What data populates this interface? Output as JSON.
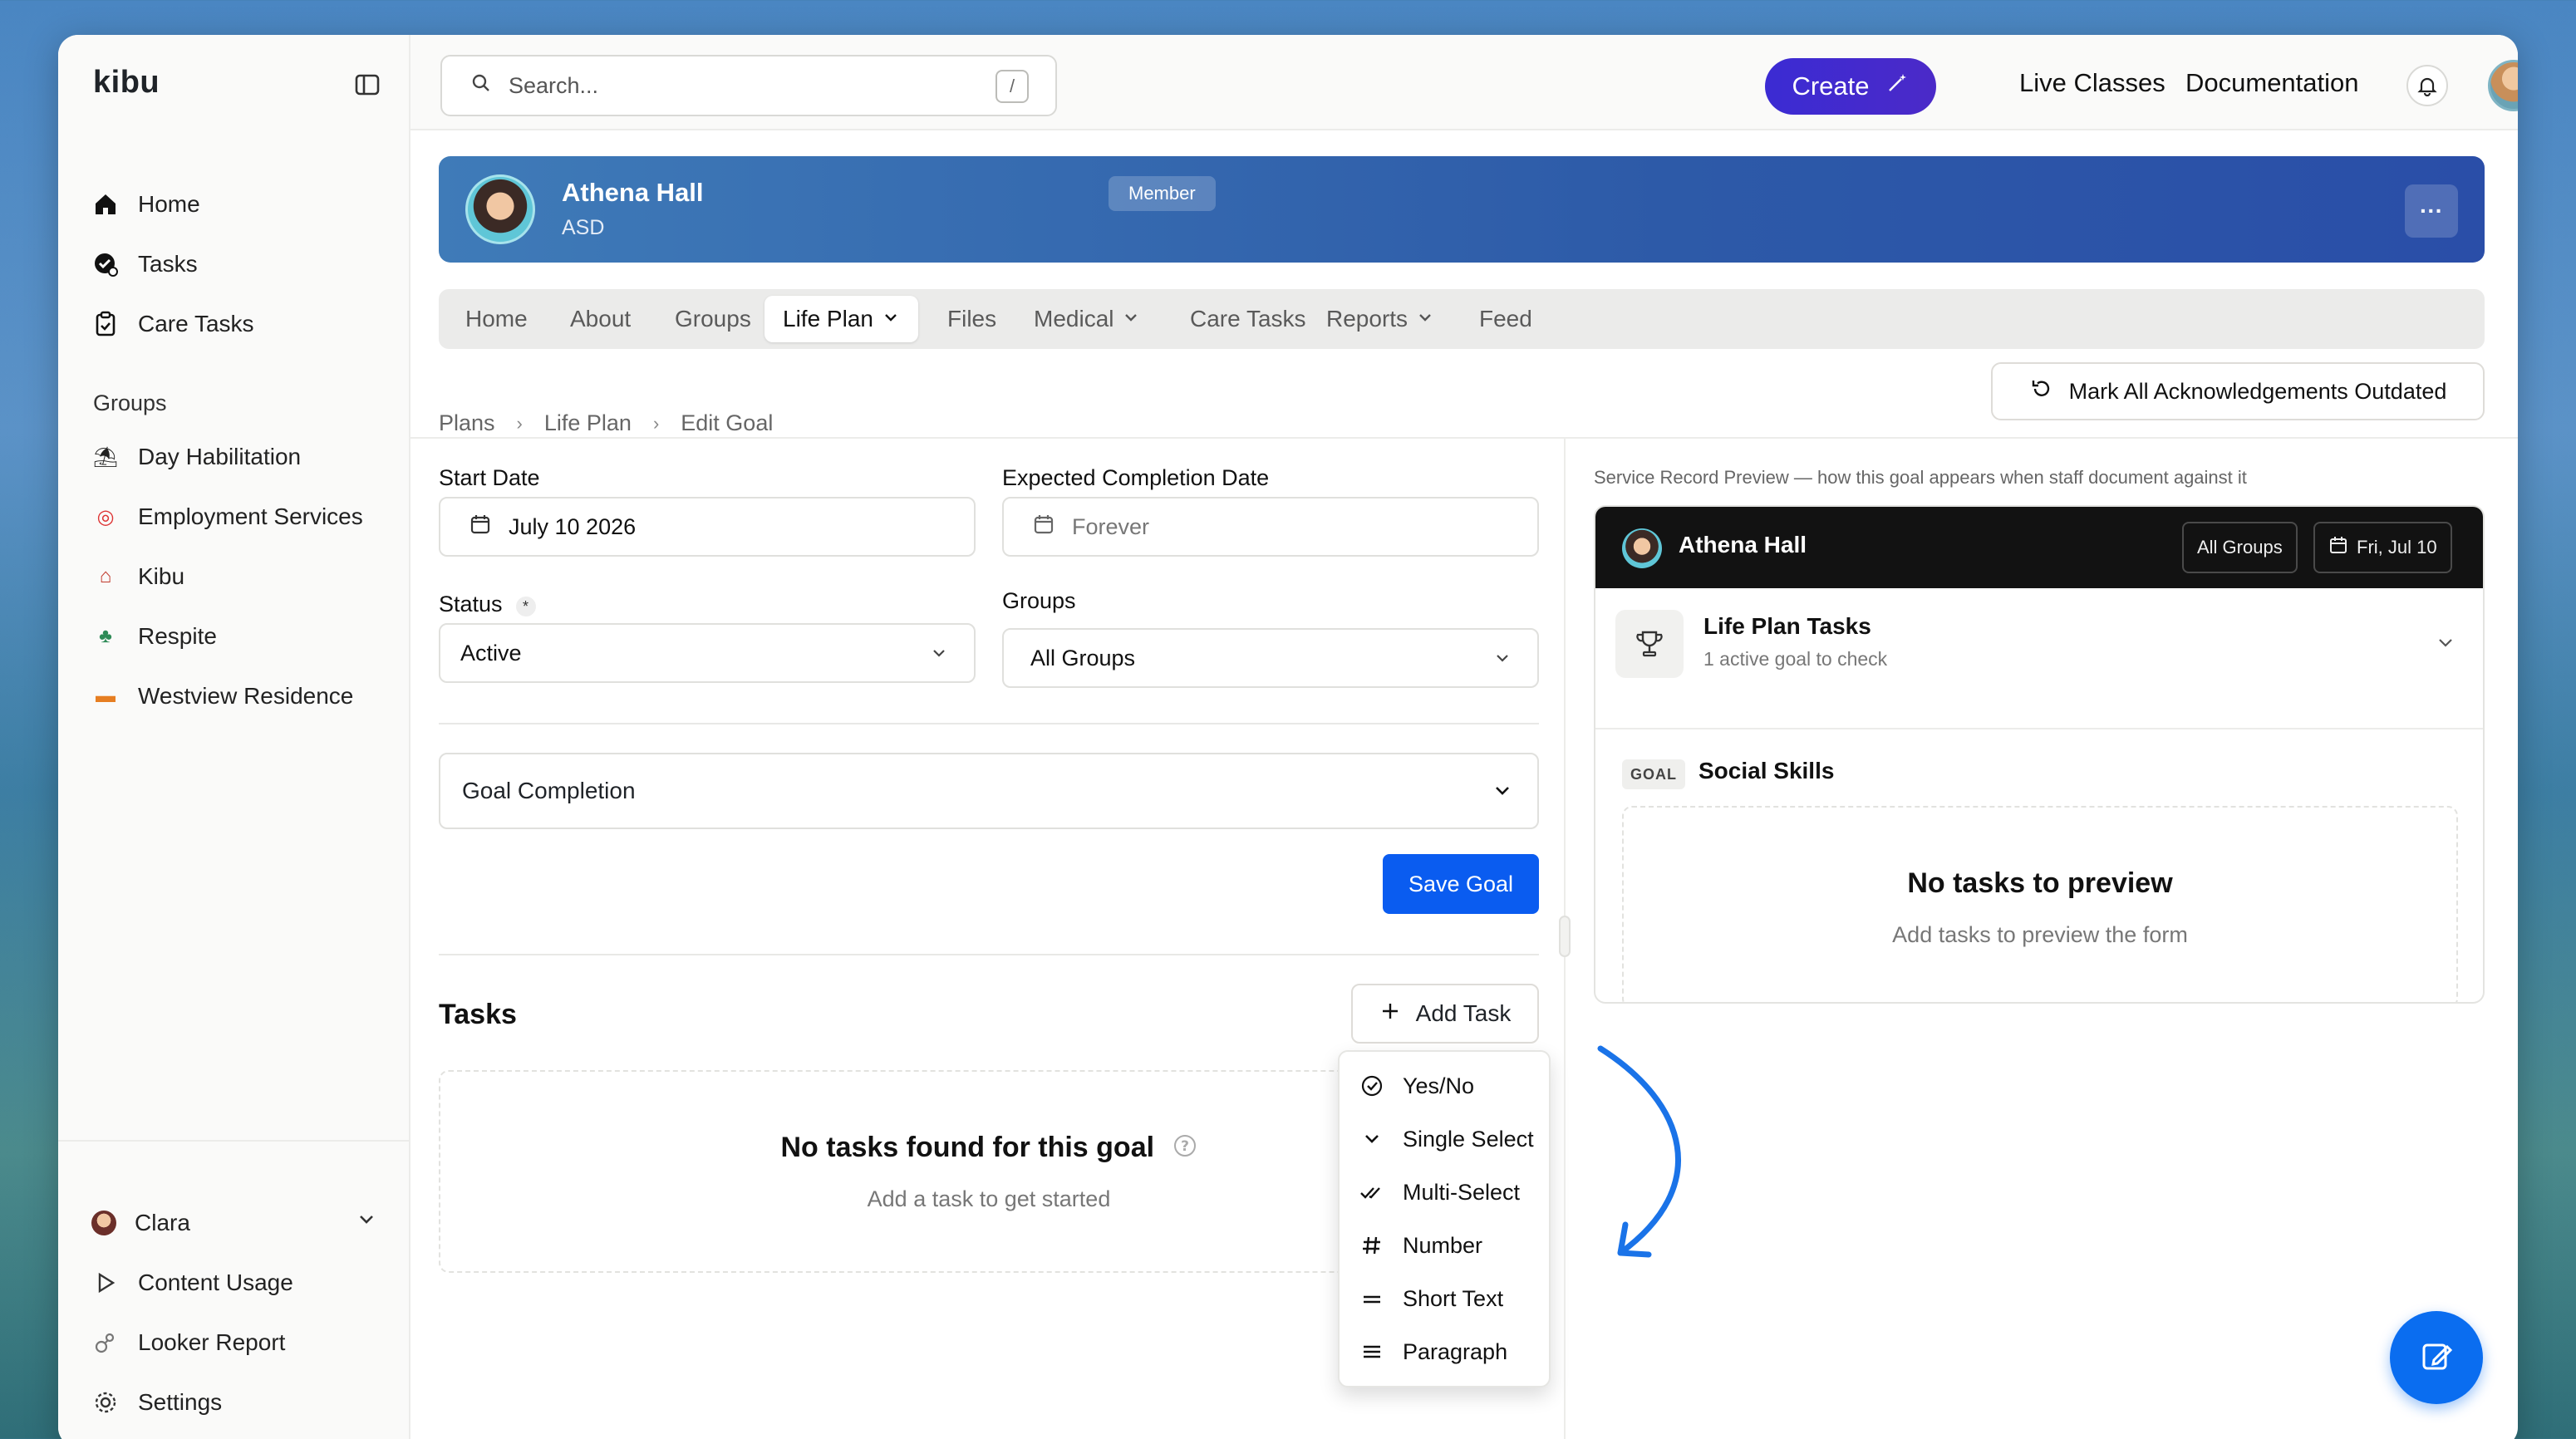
{
  "app": {
    "brand": "kibu"
  },
  "sidebar": {
    "items": [
      {
        "label": "Home",
        "icon": "home-icon"
      },
      {
        "label": "Tasks",
        "icon": "tasks-icon"
      },
      {
        "label": "Care Tasks",
        "icon": "clipboard-icon"
      }
    ],
    "groups_heading": "Groups",
    "groups": [
      {
        "label": "Day Habilitation",
        "icon": "beach-icon"
      },
      {
        "label": "Employment Services",
        "icon": "target-icon"
      },
      {
        "label": "Kibu",
        "icon": "house-icon"
      },
      {
        "label": "Respite",
        "icon": "palm-tree-icon"
      },
      {
        "label": "Westview Residence",
        "icon": "sunset-icon"
      }
    ],
    "user": "Clara",
    "bottom_items": [
      {
        "label": "Content Usage",
        "icon": "play-icon"
      },
      {
        "label": "Looker Report",
        "icon": "looker-icon"
      },
      {
        "label": "Settings",
        "icon": "gear-icon"
      }
    ]
  },
  "topbar": {
    "search_placeholder": "Search...",
    "search_shortcut": "/",
    "create_label": "Create",
    "links": [
      "Live Classes",
      "Documentation"
    ]
  },
  "profile": {
    "name": "Athena Hall",
    "badge": "Member",
    "subtitle": "ASD",
    "menu": "···"
  },
  "tabs": [
    {
      "label": "Home",
      "active": false,
      "dropdown": false
    },
    {
      "label": "About",
      "active": false,
      "dropdown": false
    },
    {
      "label": "Groups",
      "active": false,
      "dropdown": false
    },
    {
      "label": "Life Plan",
      "active": true,
      "dropdown": true
    },
    {
      "label": "Files",
      "active": false,
      "dropdown": false
    },
    {
      "label": "Medical",
      "active": false,
      "dropdown": true
    },
    {
      "label": "Care Tasks",
      "active": false,
      "dropdown": false
    },
    {
      "label": "Reports",
      "active": false,
      "dropdown": true
    },
    {
      "label": "Feed",
      "active": false,
      "dropdown": false
    }
  ],
  "breadcrumb": [
    "Plans",
    "Life Plan",
    "Edit Goal"
  ],
  "mark_outdated_label": "Mark All Acknowledgements Outdated",
  "form": {
    "start_date_label": "Start Date",
    "start_date_value": "July 10 2026",
    "completion_label": "Expected Completion Date",
    "completion_value": "Forever",
    "status_label": "Status",
    "status_required": "*",
    "status_value": "Active",
    "groups_label": "Groups",
    "groups_value": "All Groups",
    "goal_completion_label": "Goal Completion",
    "save_label": "Save Goal"
  },
  "tasks": {
    "title": "Tasks",
    "add_label": "Add Task",
    "empty_title": "No tasks found for this goal",
    "empty_sub": "Add a task to get started",
    "menu": [
      {
        "label": "Yes/No",
        "icon": "check-circle-icon"
      },
      {
        "label": "Single Select",
        "icon": "chevron-down-icon"
      },
      {
        "label": "Multi-Select",
        "icon": "double-check-icon"
      },
      {
        "label": "Number",
        "icon": "hash-icon"
      },
      {
        "label": "Short Text",
        "icon": "short-text-icon"
      },
      {
        "label": "Paragraph",
        "icon": "paragraph-icon"
      }
    ]
  },
  "preview": {
    "caption": "Service Record Preview — how this goal appears when staff document against it",
    "name": "Athena Hall",
    "groups_pill": "All Groups",
    "date_pill": "Fri, Jul 10",
    "section_title": "Life Plan Tasks",
    "section_sub": "1 active goal to check",
    "goal_tag": "GOAL",
    "goal_name": "Social Skills",
    "empty_title": "No tasks to preview",
    "empty_sub": "Add tasks to preview the form"
  },
  "colors": {
    "accent": "#0a5cf0",
    "create": "#3b2bd3",
    "banner": "#2d5aa8",
    "arrow": "#1a73e8"
  }
}
